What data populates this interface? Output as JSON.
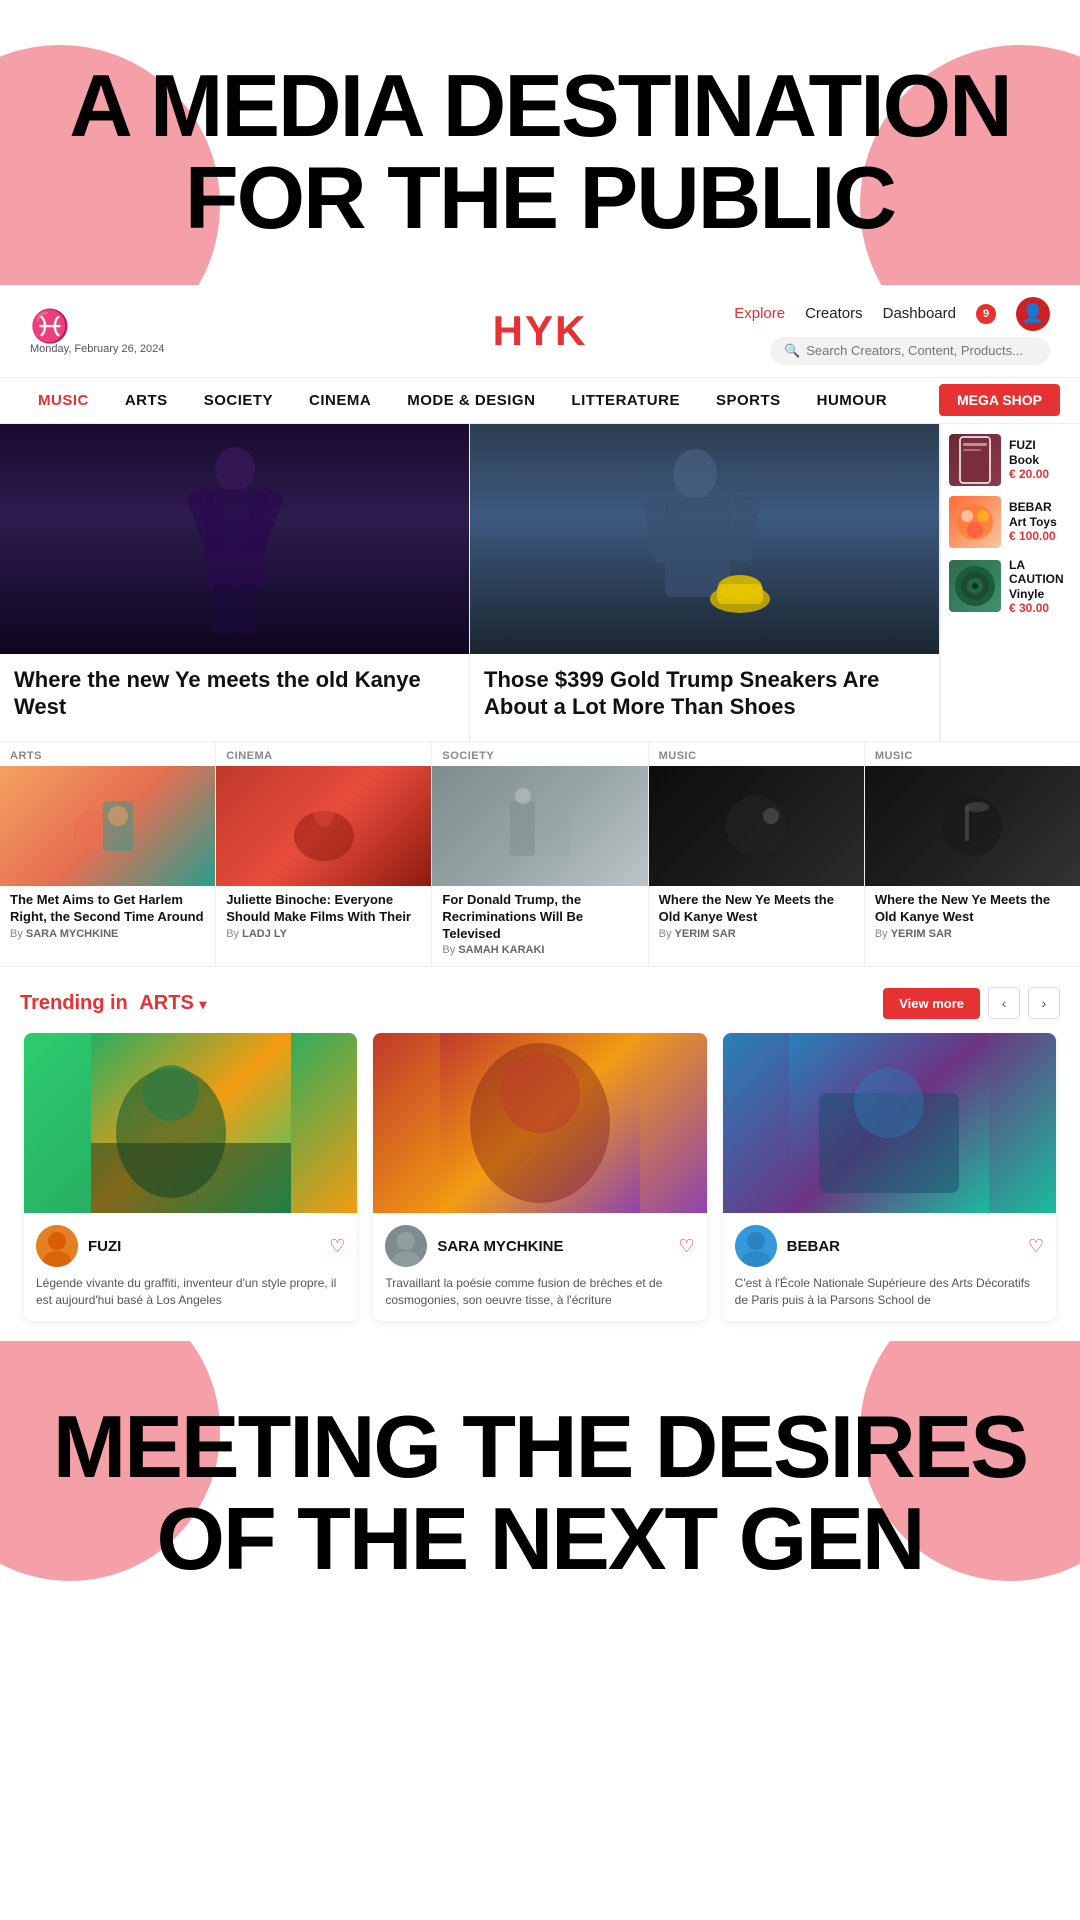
{
  "hero_top": {
    "line1": "A MEDIA DESTINATION",
    "line2": "FOR THE PUBLIC"
  },
  "navbar": {
    "symbol": "♓",
    "date": "Monday, February 26, 2024",
    "brand": "HYK",
    "links": [
      {
        "label": "Explore",
        "active": true
      },
      {
        "label": "Creators",
        "active": false
      },
      {
        "label": "Dashboard",
        "active": false
      }
    ],
    "badge": "9",
    "search_placeholder": "Search Creators, Content, Products..."
  },
  "categories": [
    {
      "label": "MUSIC",
      "red": true
    },
    {
      "label": "ARTS",
      "red": true
    },
    {
      "label": "SOCIETY",
      "red": true
    },
    {
      "label": "CINEMA",
      "red": true
    },
    {
      "label": "MODE & DESIGN",
      "red": true
    },
    {
      "label": "LITTERATURE",
      "red": true
    },
    {
      "label": "SPORTS",
      "red": true
    },
    {
      "label": "HUMOUR",
      "red": true
    }
  ],
  "mega_shop": "MEGA SHOP",
  "featured": {
    "left": {
      "title": "Where the new Ye meets the old Kanye West",
      "subtitle": ""
    },
    "right": {
      "title": "Those $399 Gold Trump Sneakers Are About a Lot More Than Shoes",
      "subtitle": ""
    }
  },
  "shop_items": [
    {
      "name": "FUZI\nBook",
      "price": "€ 20.00"
    },
    {
      "name": "BEBAR\nArt Toys",
      "price": "€ 100.00"
    },
    {
      "name": "LA CAUTION\nVinyle",
      "price": "€ 30.00"
    }
  ],
  "small_articles": [
    {
      "category": "ARTS",
      "title": "The Met Aims to Get Harlem Right, the Second Time Around",
      "author": "SARA MYCHKINE"
    },
    {
      "category": "CINEMA",
      "title": "Juliette Binoche: Everyone Should Make Films With Their",
      "author": "LADJ LY"
    },
    {
      "category": "SOCIETY",
      "title": "For Donald Trump, the Recriminations Will Be Televised",
      "author": "SAMAH KARAKI"
    },
    {
      "category": "MUSIC",
      "title": "Where the New Ye Meets the Old Kanye West",
      "author": "YERIM SAR"
    },
    {
      "category": "MUSIC",
      "title": "Where the New Ye Meets the Old Kanye West",
      "author": "YERIM SAR"
    }
  ],
  "trending": {
    "label": "Trending in",
    "category": "ARTS",
    "view_more": "View more",
    "arrow_left": "‹",
    "arrow_right": "›",
    "cards": [
      {
        "creator": "FUZI",
        "desc": "Légende vivante  du graffiti, inventeur d'un style propre, il est aujourd'hui basé à Los Angeles"
      },
      {
        "creator": "SARA MYCHKINE",
        "desc": "Travaillant la poésie comme fusion de brèches et de cosmogonies, son oeuvre tisse, à l'écriture"
      },
      {
        "creator": "BEBAR",
        "desc": "C'est à l'École Nationale Supérieure des Arts Décoratifs de Paris puis à la Parsons School de"
      }
    ]
  },
  "hero_bottom": {
    "line1": "MEETING THE DESIRES",
    "line2": "OF THE NEXT GEN"
  }
}
